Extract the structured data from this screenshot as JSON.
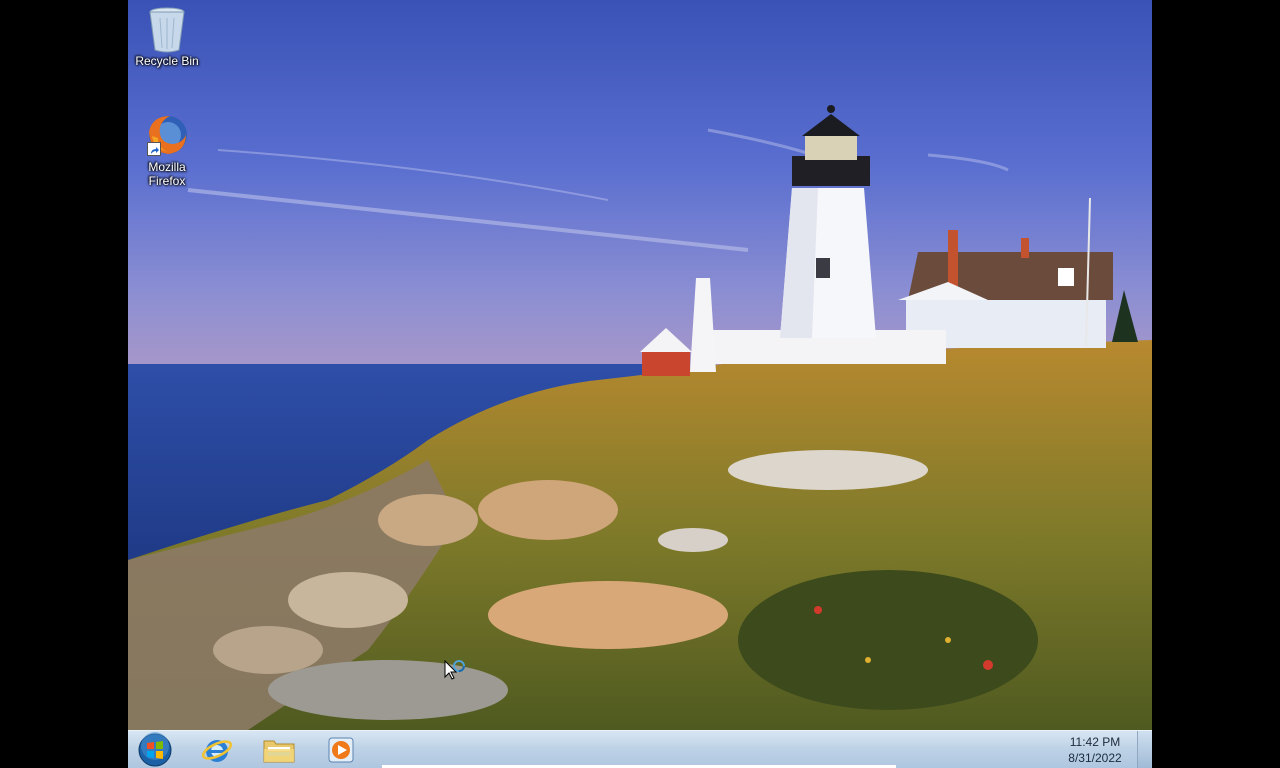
{
  "desktop": {
    "icons": [
      {
        "label": "Recycle Bin",
        "icon": "recycle-bin-icon"
      },
      {
        "label": "Mozilla Firefox",
        "icon": "firefox-icon"
      }
    ],
    "wallpaper": "lighthouse-on-rocky-coast"
  },
  "taskbar": {
    "start": {
      "icon": "windows-orb-icon"
    },
    "pinned": [
      {
        "icon": "internet-explorer-icon"
      },
      {
        "icon": "windows-explorer-icon"
      },
      {
        "icon": "windows-media-player-icon"
      }
    ],
    "clock": {
      "time": "11:42 PM",
      "date": "8/31/2022"
    }
  },
  "colors": {
    "sky_top": "#3b55b8",
    "sea": "#2a4aa0",
    "taskbar": "#bfd3e7"
  }
}
